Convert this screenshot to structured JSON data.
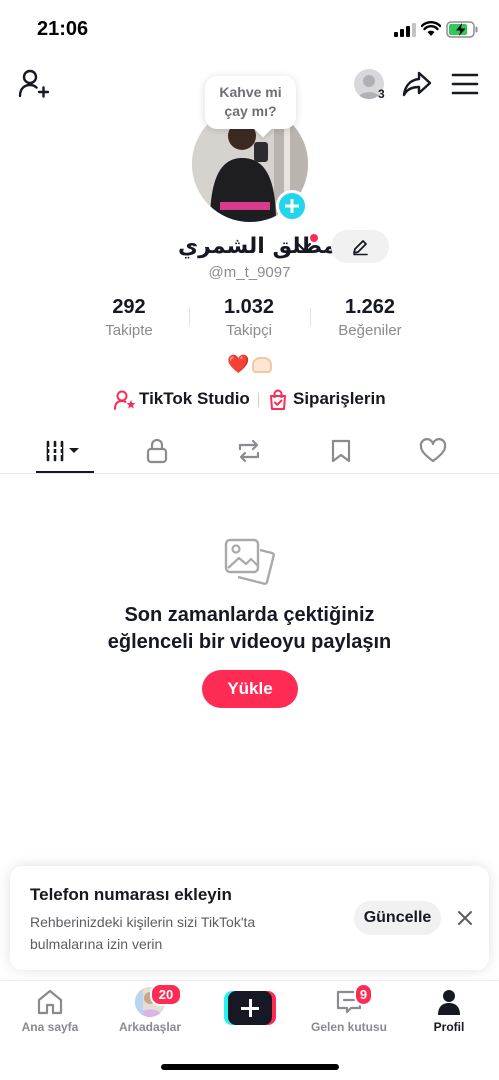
{
  "status_bar": {
    "time": "21:06",
    "signal_icon": "signal-bars-icon",
    "wifi_icon": "wifi-icon",
    "battery_icon": "battery-charging-icon"
  },
  "top_nav": {
    "profile_viewers_count": "3"
  },
  "note_bubble": {
    "line1": "Kahve mi",
    "line2": "çay mı?"
  },
  "profile": {
    "display_name": "مطلق الشمري",
    "username": "@m_t_9097"
  },
  "stats": [
    {
      "value": "292",
      "label": "Takipte"
    },
    {
      "value": "1.032",
      "label": "Takipçi"
    },
    {
      "value": "1.262",
      "label": "Beğeniler"
    }
  ],
  "bio": {
    "heart": "❤️"
  },
  "links": {
    "studio": "TikTok Studio",
    "orders": "Siparişlerin"
  },
  "empty_state": {
    "title_line1": "Son zamanlarda çektiğiniz",
    "title_line2": "eğlenceli bir videoyu paylaşın",
    "upload_label": "Yükle"
  },
  "phone_card": {
    "title": "Telefon numarası ekleyin",
    "description": "Rehberinizdeki kişilerin sizi TikTok'ta bulmalarına izin verin",
    "update_label": "Güncelle"
  },
  "bottom_nav": {
    "home": "Ana sayfa",
    "friends": "Arkadaşlar",
    "friends_badge": "20",
    "inbox": "Gelen kutusu",
    "inbox_badge": "9",
    "profile": "Profil"
  },
  "colors": {
    "accent": "#fe2c55",
    "cyan": "#20d5ec",
    "text": "#161823",
    "muted": "#8a8b91"
  }
}
